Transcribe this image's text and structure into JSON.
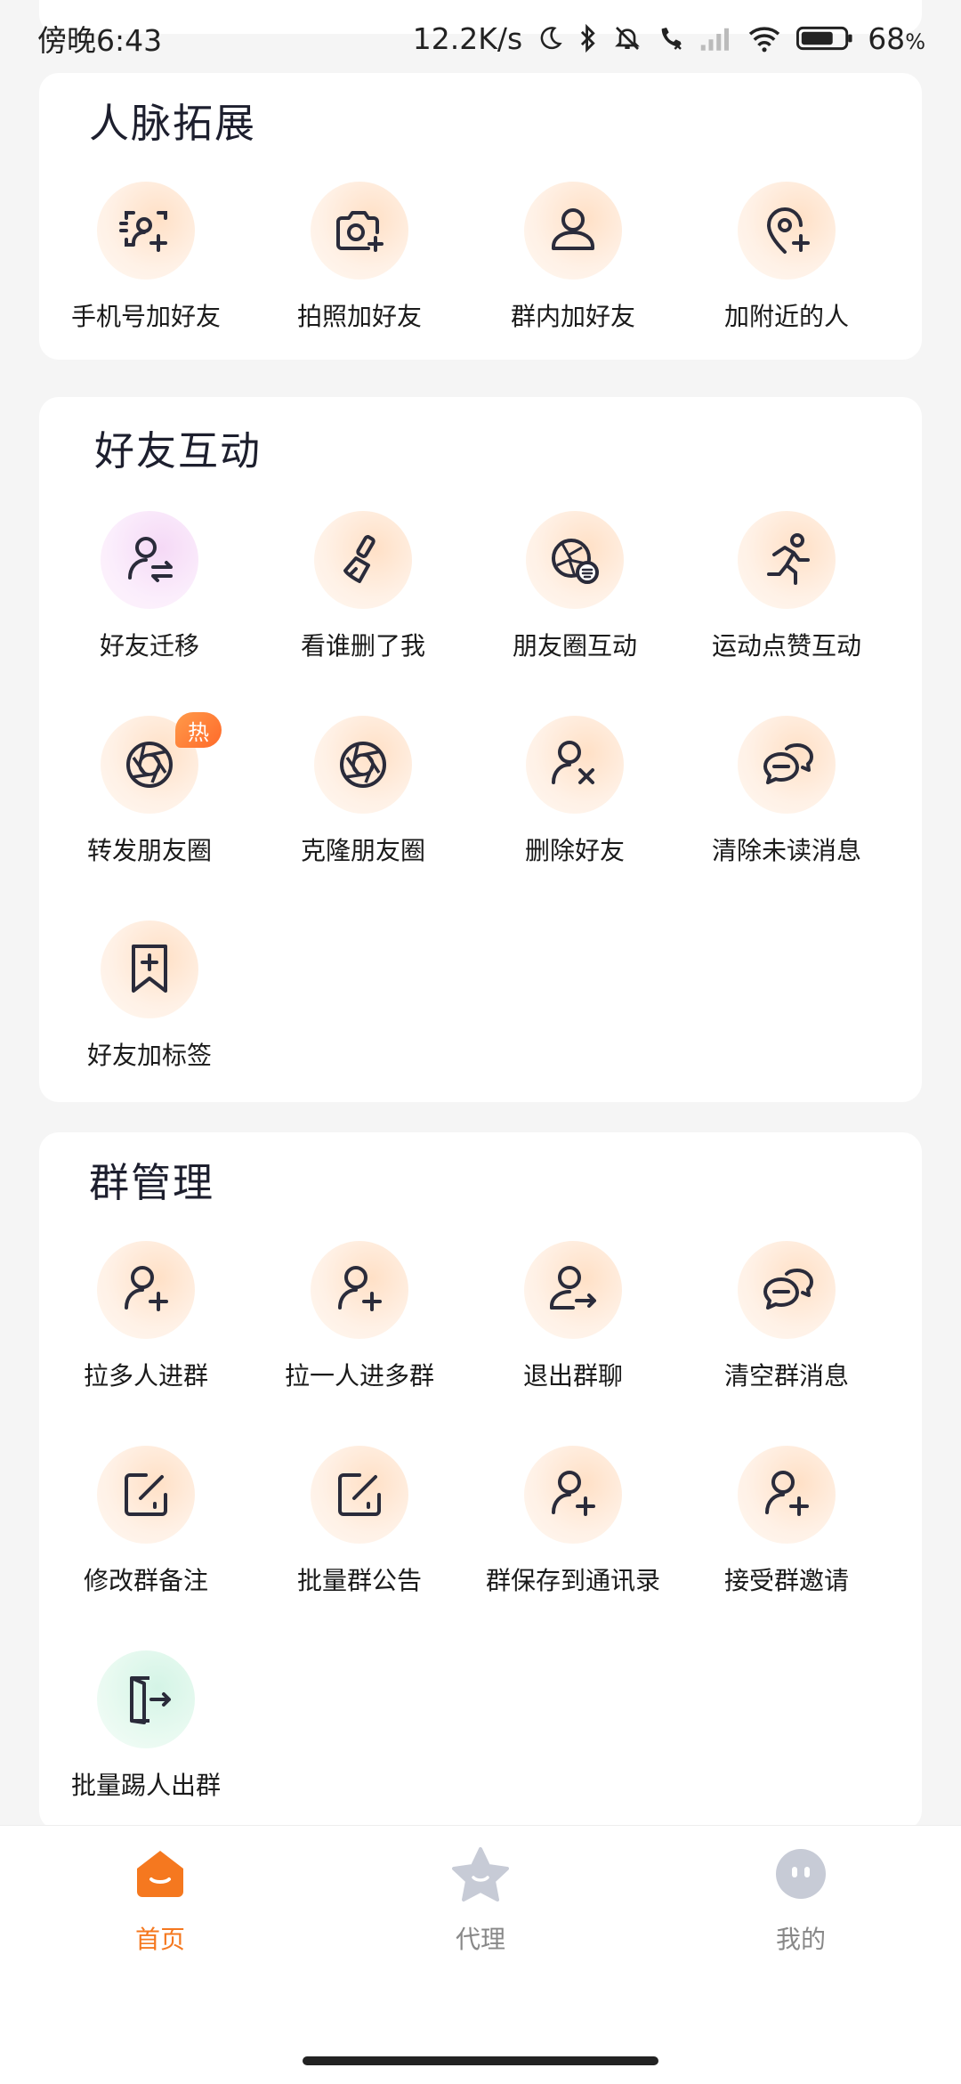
{
  "status_bar": {
    "time": "傍晚6:43",
    "net_speed": "12.2K/s",
    "battery_percent": "68",
    "battery_unit": "%"
  },
  "sections": {
    "network": {
      "title": "人脉拓展",
      "items": [
        {
          "label": "手机号加好友",
          "icon": "phone-contact-add-icon"
        },
        {
          "label": "拍照加好友",
          "icon": "camera-add-icon"
        },
        {
          "label": "群内加好友",
          "icon": "user-icon"
        },
        {
          "label": "加附近的人",
          "icon": "location-add-icon"
        }
      ]
    },
    "friends": {
      "title": "好友互动",
      "items": [
        {
          "label": "好友迁移",
          "icon": "user-transfer-icon"
        },
        {
          "label": "看谁删了我",
          "icon": "brush-icon"
        },
        {
          "label": "朋友圈互动",
          "icon": "moments-interact-icon"
        },
        {
          "label": "运动点赞互动",
          "icon": "running-icon"
        },
        {
          "label": "转发朋友圈",
          "icon": "aperture-icon",
          "badge": "热"
        },
        {
          "label": "克隆朋友圈",
          "icon": "aperture-icon"
        },
        {
          "label": "删除好友",
          "icon": "user-remove-icon"
        },
        {
          "label": "清除未读消息",
          "icon": "chat-bubbles-icon"
        },
        {
          "label": "好友加标签",
          "icon": "bookmark-add-icon"
        }
      ]
    },
    "groups": {
      "title": "群管理",
      "items": [
        {
          "label": "拉多人进群",
          "icon": "user-add-icon"
        },
        {
          "label": "拉一人进多群",
          "icon": "user-add-icon"
        },
        {
          "label": "退出群聊",
          "icon": "user-exit-icon"
        },
        {
          "label": "清空群消息",
          "icon": "chat-bubbles-icon"
        },
        {
          "label": "修改群备注",
          "icon": "edit-icon"
        },
        {
          "label": "批量群公告",
          "icon": "edit-icon"
        },
        {
          "label": "群保存到通讯录",
          "icon": "user-add-icon"
        },
        {
          "label": "接受群邀请",
          "icon": "user-add-icon"
        },
        {
          "label": "批量踢人出群",
          "icon": "door-exit-icon"
        }
      ]
    }
  },
  "bottom_nav": {
    "items": [
      {
        "label": "首页",
        "active": true,
        "icon": "home-icon"
      },
      {
        "label": "代理",
        "active": false,
        "icon": "star-icon"
      },
      {
        "label": "我的",
        "active": false,
        "icon": "profile-face-icon"
      }
    ]
  },
  "colors": {
    "accent": "#f5781f",
    "inactive": "#888888",
    "icon_stroke": "#2a2b3a"
  }
}
